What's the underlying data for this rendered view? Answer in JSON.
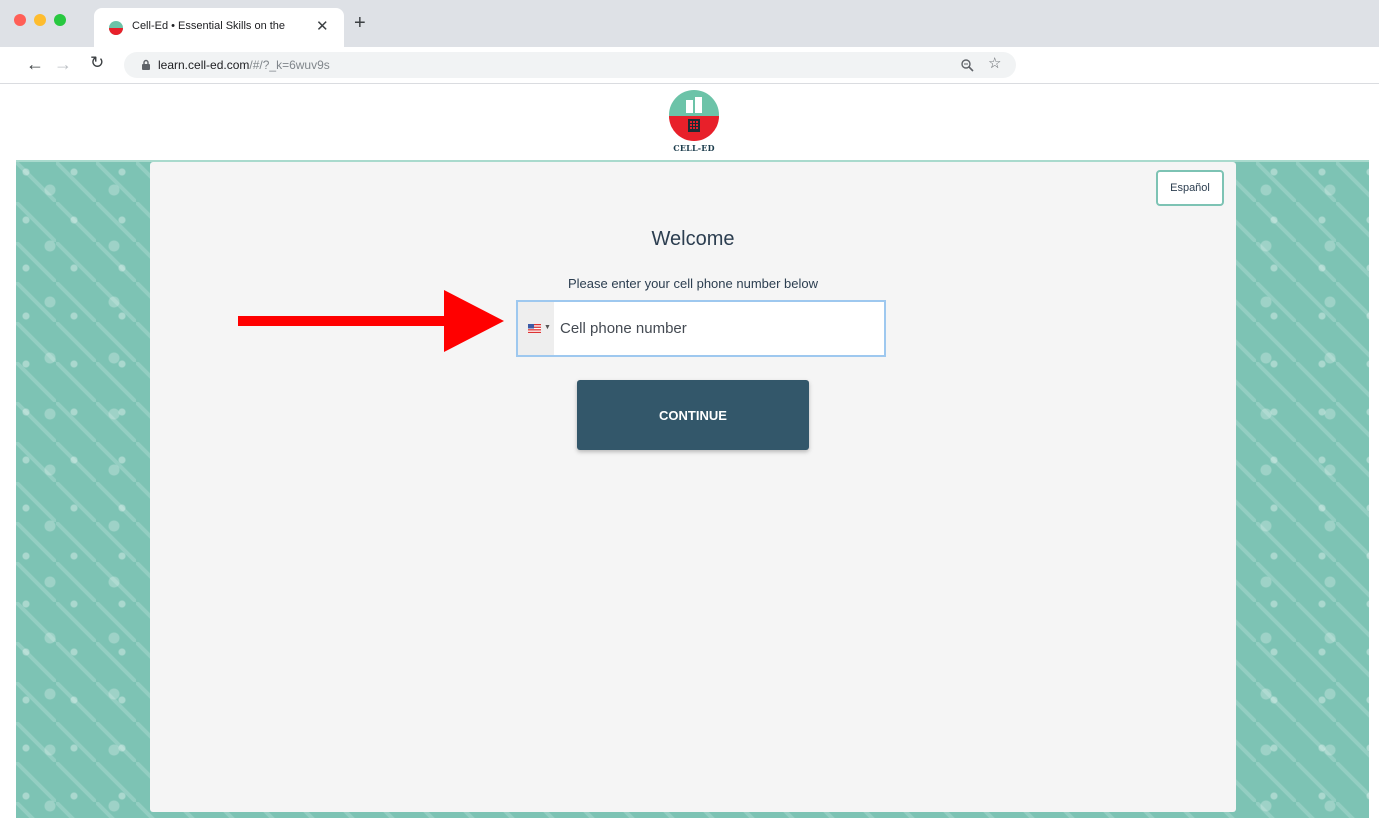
{
  "browser": {
    "tab_title": "Cell-Ed • Essential Skills on the",
    "url_host": "learn.cell-ed.com",
    "url_path": "/#/?_k=6wuv9s"
  },
  "header": {
    "logo_text": "CELL-ED"
  },
  "card": {
    "language_button": "Español",
    "welcome": "Welcome",
    "prompt": "Please enter your cell phone number below",
    "phone_placeholder": "Cell phone number",
    "continue_label": "CONTINUE"
  },
  "colors": {
    "pattern_bg": "#7dc3b4",
    "button_bg": "#33576a",
    "logo_red": "#e8202a",
    "logo_teal": "#6cc3a8",
    "arrow_red": "#ff0000"
  },
  "icons": {
    "back": "arrow-left-icon",
    "forward": "arrow-right-icon",
    "reload": "reload-icon",
    "lock": "lock-icon",
    "zoom": "zoom-icon",
    "bookmark": "star-icon",
    "flag": "us-flag-icon"
  }
}
